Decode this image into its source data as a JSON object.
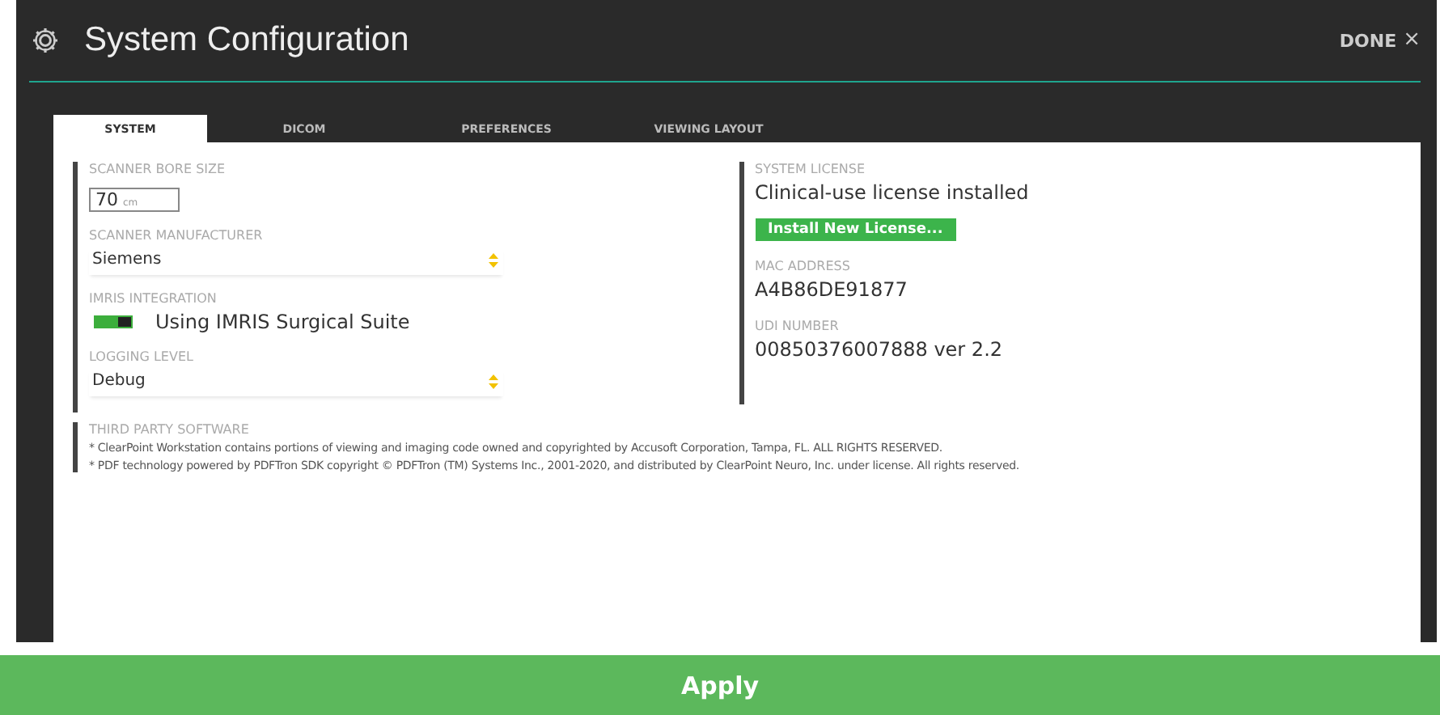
{
  "window": {
    "title": "System Configuration",
    "done": "DONE",
    "close": "×"
  },
  "tabs": [
    {
      "label": "SYSTEM",
      "selected": true
    },
    {
      "label": "DICOM",
      "selected": false
    },
    {
      "label": "PREFERENCES",
      "selected": false
    },
    {
      "label": "VIEWING LAYOUT",
      "selected": false
    }
  ],
  "left": [
    {
      "kind": "number",
      "label": "SCANNER BORE SIZE",
      "value": "70",
      "unit": "cm"
    },
    {
      "kind": "select",
      "label": "SCANNER MANUFACTURER",
      "value": "Siemens"
    },
    {
      "kind": "toggle",
      "label": "IMRIS INTEGRATION",
      "text": "Using IMRIS Surgical Suite",
      "on": true
    },
    {
      "kind": "select",
      "label": "LOGGING LEVEL",
      "value": "Debug"
    }
  ],
  "right": [
    {
      "kind": "license",
      "label": "SYSTEM LICENSE",
      "value": "Clinical-use license installed",
      "button": "Install New License..."
    },
    {
      "kind": "text",
      "label": "MAC ADDRESS",
      "value": "A4B86DE91877"
    },
    {
      "kind": "text",
      "label": "UDI NUMBER",
      "value": "00850376007888 ver 2.2"
    }
  ],
  "third_party": {
    "label": "THIRD PARTY SOFTWARE",
    "lines": [
      "* ClearPoint Workstation contains portions of viewing and imaging code owned and copyrighted by Accusoft Corporation, Tampa, FL. ALL RIGHTS RESERVED.",
      "* PDF technology powered by PDFTron SDK copyright © PDFTron (TM) Systems Inc., 2001-2020, and distributed by ClearPoint Neuro, Inc. under license. All rights reserved."
    ]
  },
  "apply": "Apply"
}
